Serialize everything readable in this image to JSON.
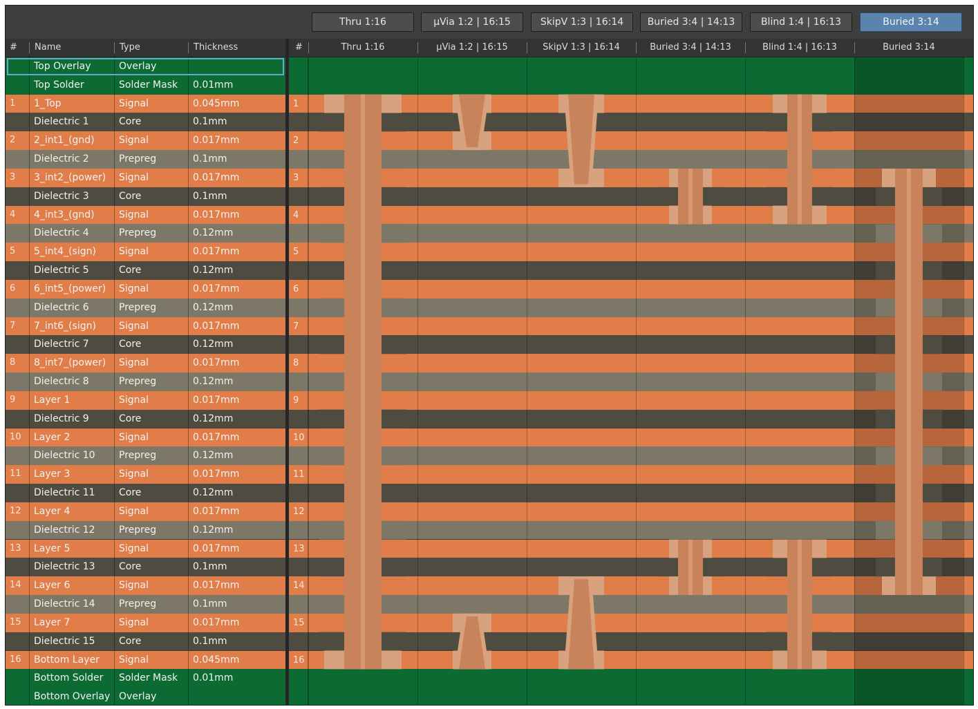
{
  "toolbar": {
    "via_tabs": [
      {
        "label": "Thru 1:16",
        "active": false
      },
      {
        "label": "µVia 1:2 | 16:15",
        "active": false
      },
      {
        "label": "SkipV 1:3 | 16:14",
        "active": false
      },
      {
        "label": "Buried 3:4 | 14:13",
        "active": false
      },
      {
        "label": "Blind 1:4 | 16:13",
        "active": false
      },
      {
        "label": "Buried 3:14",
        "active": true
      }
    ]
  },
  "table": {
    "headers": {
      "num": "#",
      "name": "Name",
      "type": "Type",
      "thickness": "Thickness"
    },
    "layers": [
      {
        "num": "",
        "name": "Top Overlay",
        "type": "Overlay",
        "thickness": "",
        "kind": "overlay"
      },
      {
        "num": "",
        "name": "Top Solder",
        "type": "Solder Mask",
        "thickness": "0.01mm",
        "kind": "mask"
      },
      {
        "num": "1",
        "name": "1_Top",
        "type": "Signal",
        "thickness": "0.045mm",
        "kind": "signal"
      },
      {
        "num": "",
        "name": "Dielectric 1",
        "type": "Core",
        "thickness": "0.1mm",
        "kind": "core"
      },
      {
        "num": "2",
        "name": "2_int1_(gnd)",
        "type": "Signal",
        "thickness": "0.017mm",
        "kind": "signal"
      },
      {
        "num": "",
        "name": "Dielectric 2",
        "type": "Prepreg",
        "thickness": "0.1mm",
        "kind": "prepreg"
      },
      {
        "num": "3",
        "name": "3_int2_(power)",
        "type": "Signal",
        "thickness": "0.017mm",
        "kind": "signal"
      },
      {
        "num": "",
        "name": "Dielectric 3",
        "type": "Core",
        "thickness": "0.1mm",
        "kind": "core"
      },
      {
        "num": "4",
        "name": "4_int3_(gnd)",
        "type": "Signal",
        "thickness": "0.017mm",
        "kind": "signal"
      },
      {
        "num": "",
        "name": "Dielectric 4",
        "type": "Prepreg",
        "thickness": "0.12mm",
        "kind": "prepreg"
      },
      {
        "num": "5",
        "name": "5_int4_(sign)",
        "type": "Signal",
        "thickness": "0.017mm",
        "kind": "signal"
      },
      {
        "num": "",
        "name": "Dielectric 5",
        "type": "Core",
        "thickness": "0.12mm",
        "kind": "core"
      },
      {
        "num": "6",
        "name": "6_int5_(power)",
        "type": "Signal",
        "thickness": "0.017mm",
        "kind": "signal"
      },
      {
        "num": "",
        "name": "Dielectric 6",
        "type": "Prepreg",
        "thickness": "0.12mm",
        "kind": "prepreg"
      },
      {
        "num": "7",
        "name": "7_int6_(sign)",
        "type": "Signal",
        "thickness": "0.017mm",
        "kind": "signal"
      },
      {
        "num": "",
        "name": "Dielectric 7",
        "type": "Core",
        "thickness": "0.12mm",
        "kind": "core"
      },
      {
        "num": "8",
        "name": "8_int7_(power)",
        "type": "Signal",
        "thickness": "0.017mm",
        "kind": "signal"
      },
      {
        "num": "",
        "name": "Dielectric 8",
        "type": "Prepreg",
        "thickness": "0.12mm",
        "kind": "prepreg"
      },
      {
        "num": "9",
        "name": "Layer 1",
        "type": "Signal",
        "thickness": "0.017mm",
        "kind": "signal"
      },
      {
        "num": "",
        "name": "Dielectric 9",
        "type": "Core",
        "thickness": "0.12mm",
        "kind": "core"
      },
      {
        "num": "10",
        "name": "Layer 2",
        "type": "Signal",
        "thickness": "0.017mm",
        "kind": "signal"
      },
      {
        "num": "",
        "name": "Dielectric 10",
        "type": "Prepreg",
        "thickness": "0.12mm",
        "kind": "prepreg"
      },
      {
        "num": "11",
        "name": "Layer 3",
        "type": "Signal",
        "thickness": "0.017mm",
        "kind": "signal"
      },
      {
        "num": "",
        "name": "Dielectric 11",
        "type": "Core",
        "thickness": "0.12mm",
        "kind": "core"
      },
      {
        "num": "12",
        "name": "Layer 4",
        "type": "Signal",
        "thickness": "0.017mm",
        "kind": "signal"
      },
      {
        "num": "",
        "name": "Dielectric 12",
        "type": "Prepreg",
        "thickness": "0.12mm",
        "kind": "prepreg"
      },
      {
        "num": "13",
        "name": "Layer 5",
        "type": "Signal",
        "thickness": "0.017mm",
        "kind": "signal"
      },
      {
        "num": "",
        "name": "Dielectric 13",
        "type": "Core",
        "thickness": "0.1mm",
        "kind": "core"
      },
      {
        "num": "14",
        "name": "Layer 6",
        "type": "Signal",
        "thickness": "0.017mm",
        "kind": "signal"
      },
      {
        "num": "",
        "name": "Dielectric 14",
        "type": "Prepreg",
        "thickness": "0.1mm",
        "kind": "prepreg"
      },
      {
        "num": "15",
        "name": "Layer 7",
        "type": "Signal",
        "thickness": "0.017mm",
        "kind": "signal"
      },
      {
        "num": "",
        "name": "Dielectric 15",
        "type": "Core",
        "thickness": "0.1mm",
        "kind": "core"
      },
      {
        "num": "16",
        "name": "Bottom Layer",
        "type": "Signal",
        "thickness": "0.045mm",
        "kind": "signal"
      },
      {
        "num": "",
        "name": "Bottom Solder",
        "type": "Solder Mask",
        "thickness": "0.01mm",
        "kind": "mask"
      },
      {
        "num": "",
        "name": "Bottom Overlay",
        "type": "Overlay",
        "thickness": "",
        "kind": "overlay"
      }
    ]
  },
  "via_columns": [
    {
      "label": "Thru 1:16",
      "type": "thru",
      "from": 1,
      "to": 16
    },
    {
      "label": "µVia 1:2 | 16:15",
      "type": "microvia",
      "spans": [
        [
          1,
          2
        ],
        [
          16,
          15
        ]
      ]
    },
    {
      "label": "SkipV 1:3 | 16:14",
      "type": "skipvia",
      "spans": [
        [
          1,
          3
        ],
        [
          16,
          14
        ]
      ]
    },
    {
      "label": "Buried 3:4 | 14:13",
      "type": "buried",
      "spans": [
        [
          3,
          4
        ],
        [
          14,
          13
        ]
      ]
    },
    {
      "label": "Blind 1:4 | 16:13",
      "type": "blind",
      "spans": [
        [
          1,
          4
        ],
        [
          16,
          13
        ]
      ]
    },
    {
      "label": "Buried 3:14",
      "type": "buried",
      "spans": [
        [
          3,
          14
        ]
      ],
      "selected": true
    }
  ],
  "colors": {
    "signal": "#e07d48",
    "core": "#4e4b40",
    "prepreg": "#7c7766",
    "mask": "#0b6b33",
    "overlay": "#0b6b33",
    "pad": "#d9a27f",
    "barrel": "#c8835b",
    "accent": "#5a84ad"
  }
}
